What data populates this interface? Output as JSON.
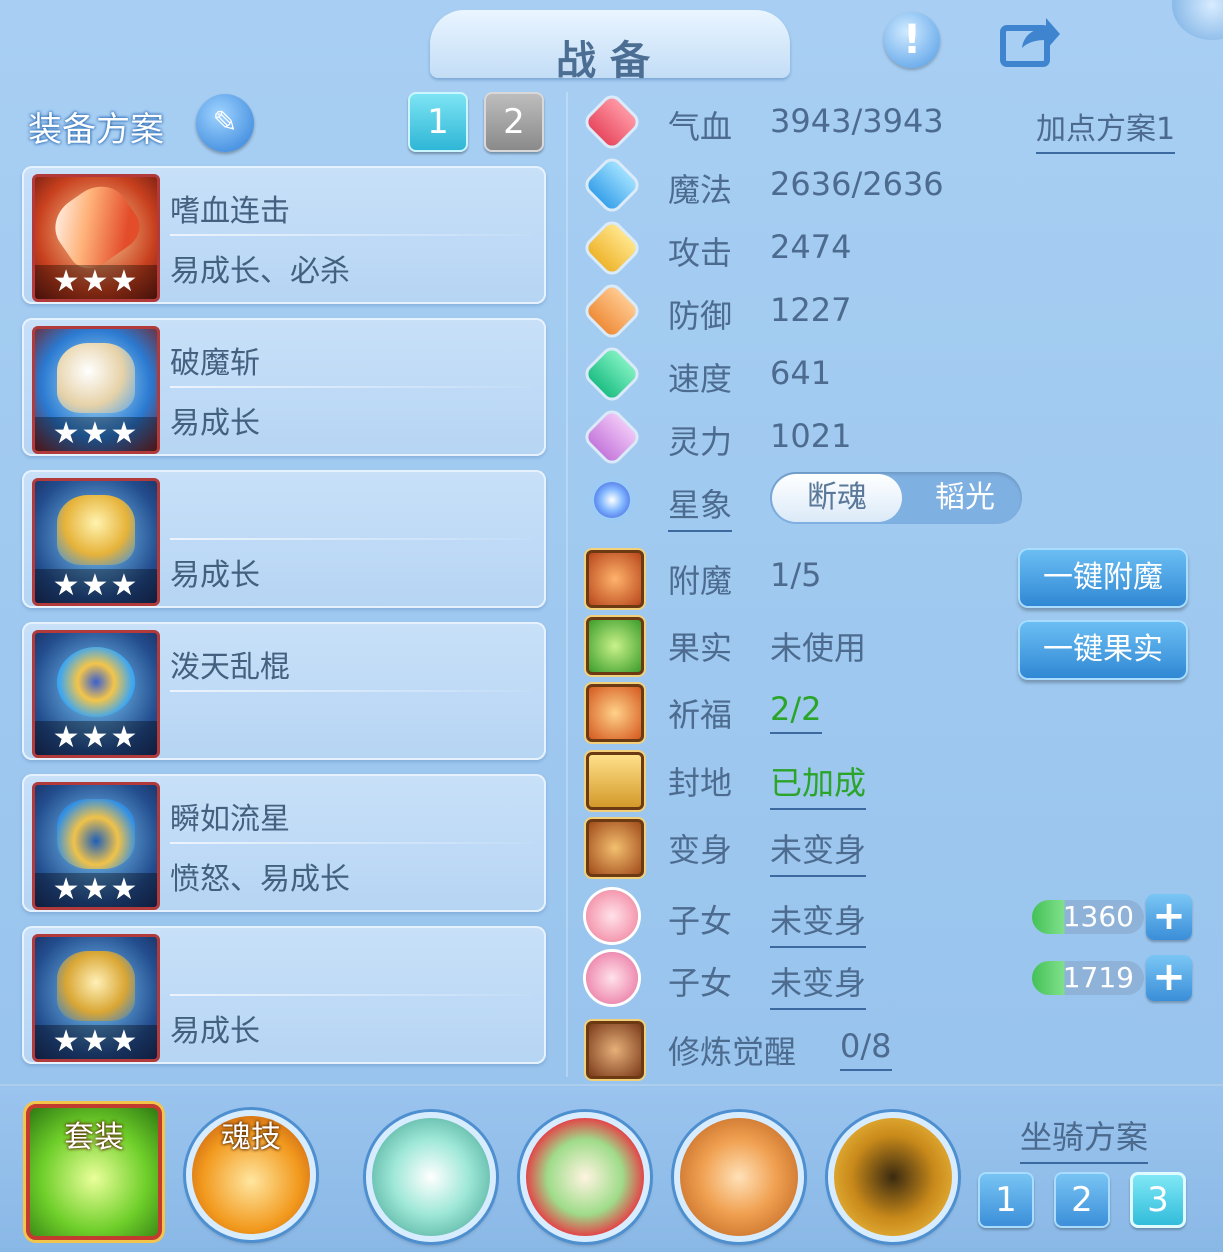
{
  "header": {
    "title": "战备",
    "info_icon": "exclamation-icon",
    "share_icon": "share-icon"
  },
  "equipment_plan": {
    "label": "装备方案",
    "edit_icon": "pencil-icon",
    "tabs": [
      "1",
      "2"
    ],
    "active_tab": "1",
    "items": [
      {
        "name": "嗜血连击",
        "traits": "易成长、必杀",
        "stars": "★★★",
        "icon": "weapon-icon"
      },
      {
        "name": "破魔斩",
        "traits": "易成长",
        "stars": "★★★",
        "icon": "helmet-icon"
      },
      {
        "name": "",
        "traits": "易成长",
        "stars": "★★★",
        "icon": "armor-icon"
      },
      {
        "name": "泼天乱棍",
        "traits": "",
        "stars": "★★★",
        "icon": "necklace-icon"
      },
      {
        "name": "瞬如流星",
        "traits": "愤怒、易成长",
        "stars": "★★★",
        "icon": "belt-icon"
      },
      {
        "name": "",
        "traits": "易成长",
        "stars": "★★★",
        "icon": "boots-icon"
      }
    ]
  },
  "stats": {
    "plan_link": "加点方案1",
    "rows": [
      {
        "label": "气血",
        "value": "3943/3943",
        "icon": "heart-icon",
        "color": "#f06a7a"
      },
      {
        "label": "魔法",
        "value": "2636/2636",
        "icon": "mana-icon",
        "color": "#5ab8f0"
      },
      {
        "label": "攻击",
        "value": "2474",
        "icon": "sword-icon",
        "color": "#f3c548"
      },
      {
        "label": "防御",
        "value": "1227",
        "icon": "shield-icon",
        "color": "#f2a15a"
      },
      {
        "label": "速度",
        "value": "641",
        "icon": "lightning-icon",
        "color": "#3fd39a"
      },
      {
        "label": "灵力",
        "value": "1021",
        "icon": "spirit-icon",
        "color": "#d99ae6"
      }
    ],
    "constellation": {
      "label": "星象",
      "options": [
        "断魂",
        "韬光"
      ],
      "selected": "断魂"
    }
  },
  "enhancements": {
    "enchant": {
      "label": "附魔",
      "value": "1/5",
      "button": "一键附魔"
    },
    "fruit": {
      "label": "果实",
      "value": "未使用",
      "button": "一键果实"
    },
    "blessing": {
      "label": "祈福",
      "value": "2/2"
    },
    "fief": {
      "label": "封地",
      "value": "已加成"
    },
    "transform": {
      "label": "变身",
      "value": "未变身"
    },
    "children": [
      {
        "label": "子女",
        "value": "未变身",
        "points": "1360",
        "progress_pct": 27
      },
      {
        "label": "子女",
        "value": "未变身",
        "points": "1719",
        "progress_pct": 27
      }
    ],
    "cultivation": {
      "label": "修炼觉醒",
      "value": "0/8"
    }
  },
  "bottom": {
    "set_label": "套装",
    "soul_skill_label": "魂技",
    "skill_icons": [
      "fist-green-icon",
      "staff-red-icon",
      "fist-orange-icon",
      "shadow-warrior-icon"
    ],
    "mount_plan": {
      "label": "坐骑方案",
      "options": [
        "1",
        "2",
        "3"
      ],
      "active": "3"
    }
  }
}
